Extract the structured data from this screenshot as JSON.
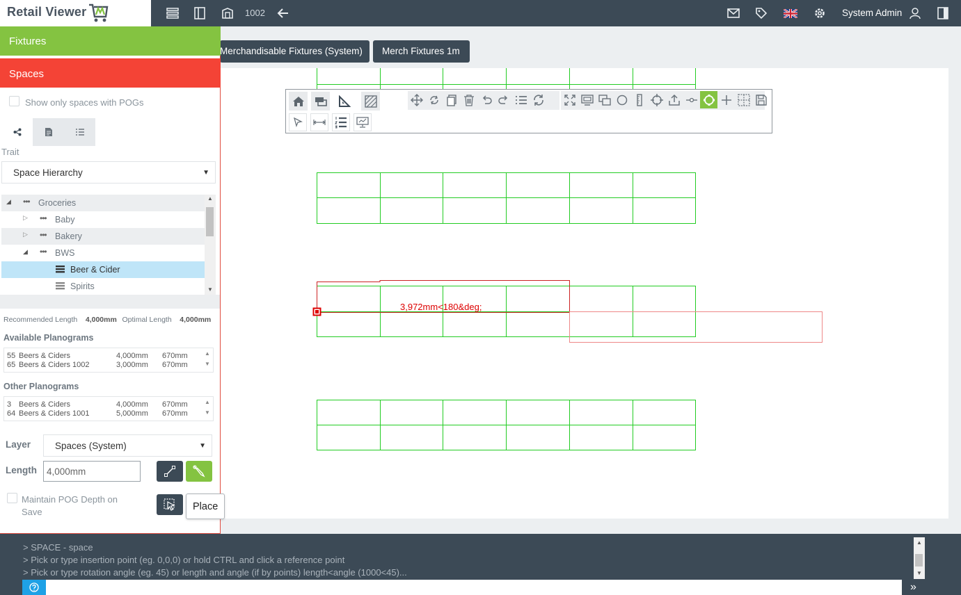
{
  "app": {
    "title": "Retail Viewer"
  },
  "topbar": {
    "store_number": "1002",
    "user_name": "System Admin",
    "icons": [
      "list-icon",
      "book-icon",
      "store-map-icon",
      "back-arrow-icon",
      "mail-icon",
      "tag-icon",
      "uk-flag-icon",
      "gear-icon",
      "user-icon",
      "panel-toggle-icon"
    ]
  },
  "left_panel": {
    "fixtures_label": "Fixtures",
    "spaces_label": "Spaces",
    "show_only_label": "Show only spaces with POGs",
    "trait_label": "Trait",
    "trait_value": "Space Hierarchy",
    "tree": [
      {
        "label": "Groceries",
        "level": 0,
        "state": "expanded"
      },
      {
        "label": "Baby",
        "level": 1,
        "state": "collapsed"
      },
      {
        "label": "Bakery",
        "level": 1,
        "state": "collapsed"
      },
      {
        "label": "BWS",
        "level": 1,
        "state": "expanded"
      },
      {
        "label": "Beer & Cider",
        "level": 2,
        "state": "selected"
      },
      {
        "label": "Spirits",
        "level": 2,
        "state": "leaf"
      }
    ],
    "recommended_length_label": "Recommended Length",
    "recommended_length_value": "4,000mm",
    "optimal_length_label": "Optimal Length",
    "optimal_length_value": "4,000mm",
    "available_title": "Available Planograms",
    "available": [
      {
        "id": "55",
        "name": "Beers & Ciders",
        "length": "4,000mm",
        "depth": "670mm"
      },
      {
        "id": "65",
        "name": "Beers & Ciders 1002",
        "length": "3,000mm",
        "depth": "670mm"
      }
    ],
    "other_title": "Other Planograms",
    "other": [
      {
        "id": "3",
        "name": "Beers & Ciders",
        "length": "4,000mm",
        "depth": "670mm"
      },
      {
        "id": "64",
        "name": "Beers & Ciders 1001",
        "length": "5,000mm",
        "depth": "670mm"
      }
    ],
    "layer_label": "Layer",
    "layer_value": "Spaces (System)",
    "length_label": "Length",
    "length_value": "4,000mm",
    "maintain_label": "Maintain POG Depth on Save",
    "place_tooltip": "Place"
  },
  "view_tabs": [
    "Merchandisable Fixtures (System)",
    "Merch Fixtures 1m"
  ],
  "canvas": {
    "measure_text": "3,972mm<180&deg;",
    "colors": {
      "fixture": "#22cc22",
      "preview": "#cc0000"
    }
  },
  "command": {
    "lines": [
      "> SPACE - space",
      "> Pick or type insertion point (eg. 0,0,0) or hold CTRL and click a reference point",
      "> Pick or type rotation angle (eg. 45) or length and angle (if by points) length<angle (1000<45)..."
    ],
    "help_icon": "question-icon",
    "go_icon": "double-chevron-right-icon"
  }
}
